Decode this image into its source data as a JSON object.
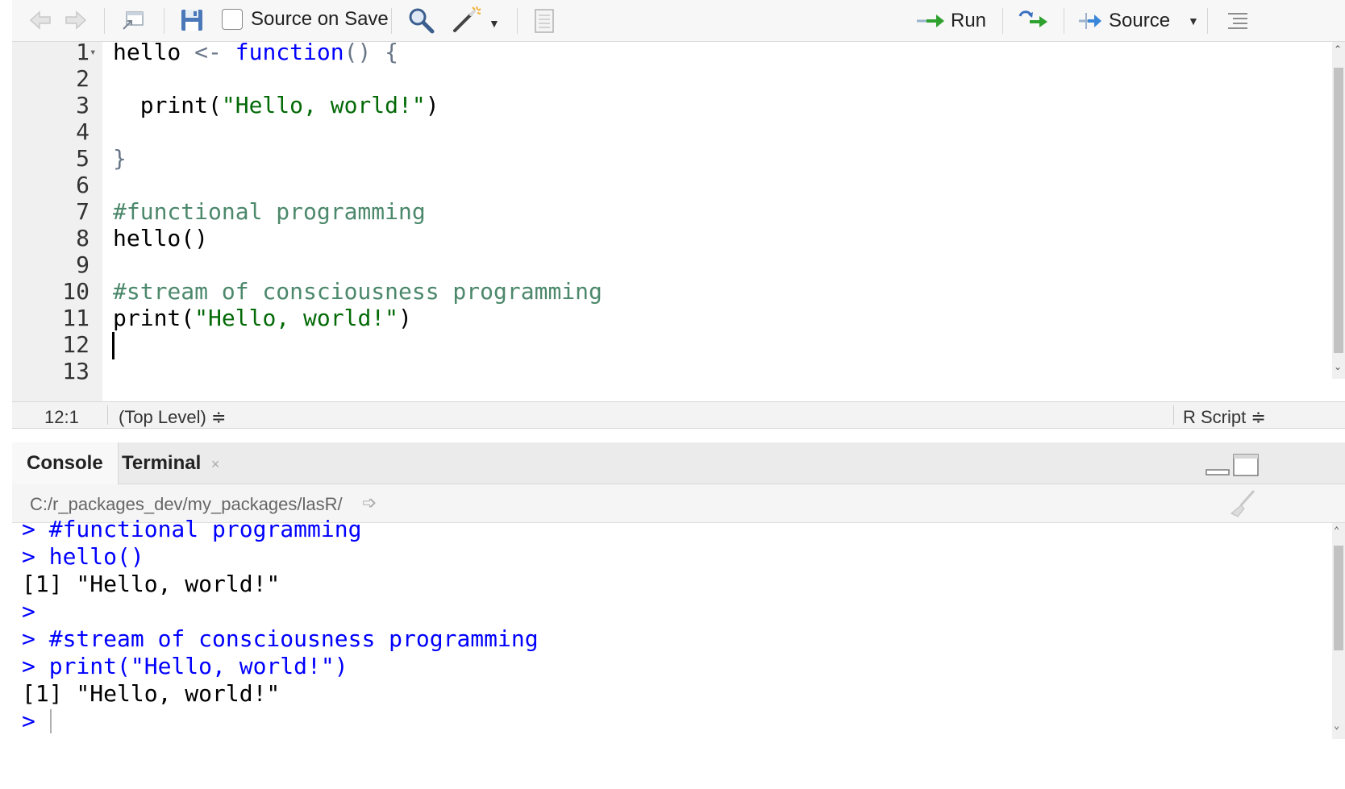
{
  "toolbar": {
    "source_on_save_label": "Source on Save",
    "run_label": "Run",
    "source_label": "Source"
  },
  "editor": {
    "line_numbers": [
      "1",
      "2",
      "3",
      "4",
      "5",
      "6",
      "7",
      "8",
      "9",
      "10",
      "11",
      "12",
      "13"
    ],
    "lines": [
      [
        {
          "t": "hello ",
          "c": "plain"
        },
        {
          "t": "<-",
          "c": "op"
        },
        {
          "t": " ",
          "c": "plain"
        },
        {
          "t": "function",
          "c": "kw"
        },
        {
          "t": "() {",
          "c": "op"
        }
      ],
      [],
      [
        {
          "t": "  print(",
          "c": "plain"
        },
        {
          "t": "\"Hello, world!\"",
          "c": "str"
        },
        {
          "t": ")",
          "c": "plain"
        }
      ],
      [],
      [
        {
          "t": "}",
          "c": "op"
        }
      ],
      [],
      [
        {
          "t": "#functional programming",
          "c": "com"
        }
      ],
      [
        {
          "t": "hello()",
          "c": "plain"
        }
      ],
      [],
      [
        {
          "t": "#stream of consciousness programming",
          "c": "com"
        }
      ],
      [
        {
          "t": "print(",
          "c": "plain"
        },
        {
          "t": "\"Hello, world!\"",
          "c": "str"
        },
        {
          "t": ")",
          "c": "plain"
        }
      ],
      [],
      []
    ]
  },
  "statusbar": {
    "position": "12:1",
    "scope": "(Top Level) ≑",
    "file_type": "R Script ≑"
  },
  "console_pane": {
    "tabs": [
      {
        "label": "Console"
      },
      {
        "label": "Terminal"
      }
    ],
    "working_dir": "C:/r_packages_dev/my_packages/lasR/",
    "lines": [
      {
        "prompt": ">",
        "text": " #functional programming",
        "kind": "input"
      },
      {
        "prompt": ">",
        "text": " hello()",
        "kind": "input"
      },
      {
        "prompt": "",
        "text": "[1] \"Hello, world!\"",
        "kind": "output"
      },
      {
        "prompt": ">",
        "text": "",
        "kind": "input"
      },
      {
        "prompt": ">",
        "text": " #stream of consciousness programming",
        "kind": "input"
      },
      {
        "prompt": ">",
        "text": " print(\"Hello, world!\")",
        "kind": "input"
      },
      {
        "prompt": "",
        "text": "[1] \"Hello, world!\"",
        "kind": "output"
      },
      {
        "prompt": ">",
        "text": " ",
        "kind": "input"
      }
    ]
  },
  "icons": {
    "back": "arrow-left-icon",
    "forward": "arrow-right-icon",
    "show_in_window": "popout-icon",
    "save": "floppy-disk-icon",
    "find": "magnifier-icon",
    "code_tools": "magic-wand-icon",
    "compile_report": "notebook-icon",
    "rerun": "rerun-icon",
    "outline": "outline-icon",
    "clear_console": "broom-icon",
    "minimize": "minimize-icon",
    "maximize": "maximize-icon",
    "wd_link": "goto-dir-icon"
  },
  "colors": {
    "keyword": "#0000ff",
    "string": "#036a07",
    "comment": "#4c886b",
    "console_input": "#0000ff",
    "run_arrow": "#2ea12e"
  }
}
